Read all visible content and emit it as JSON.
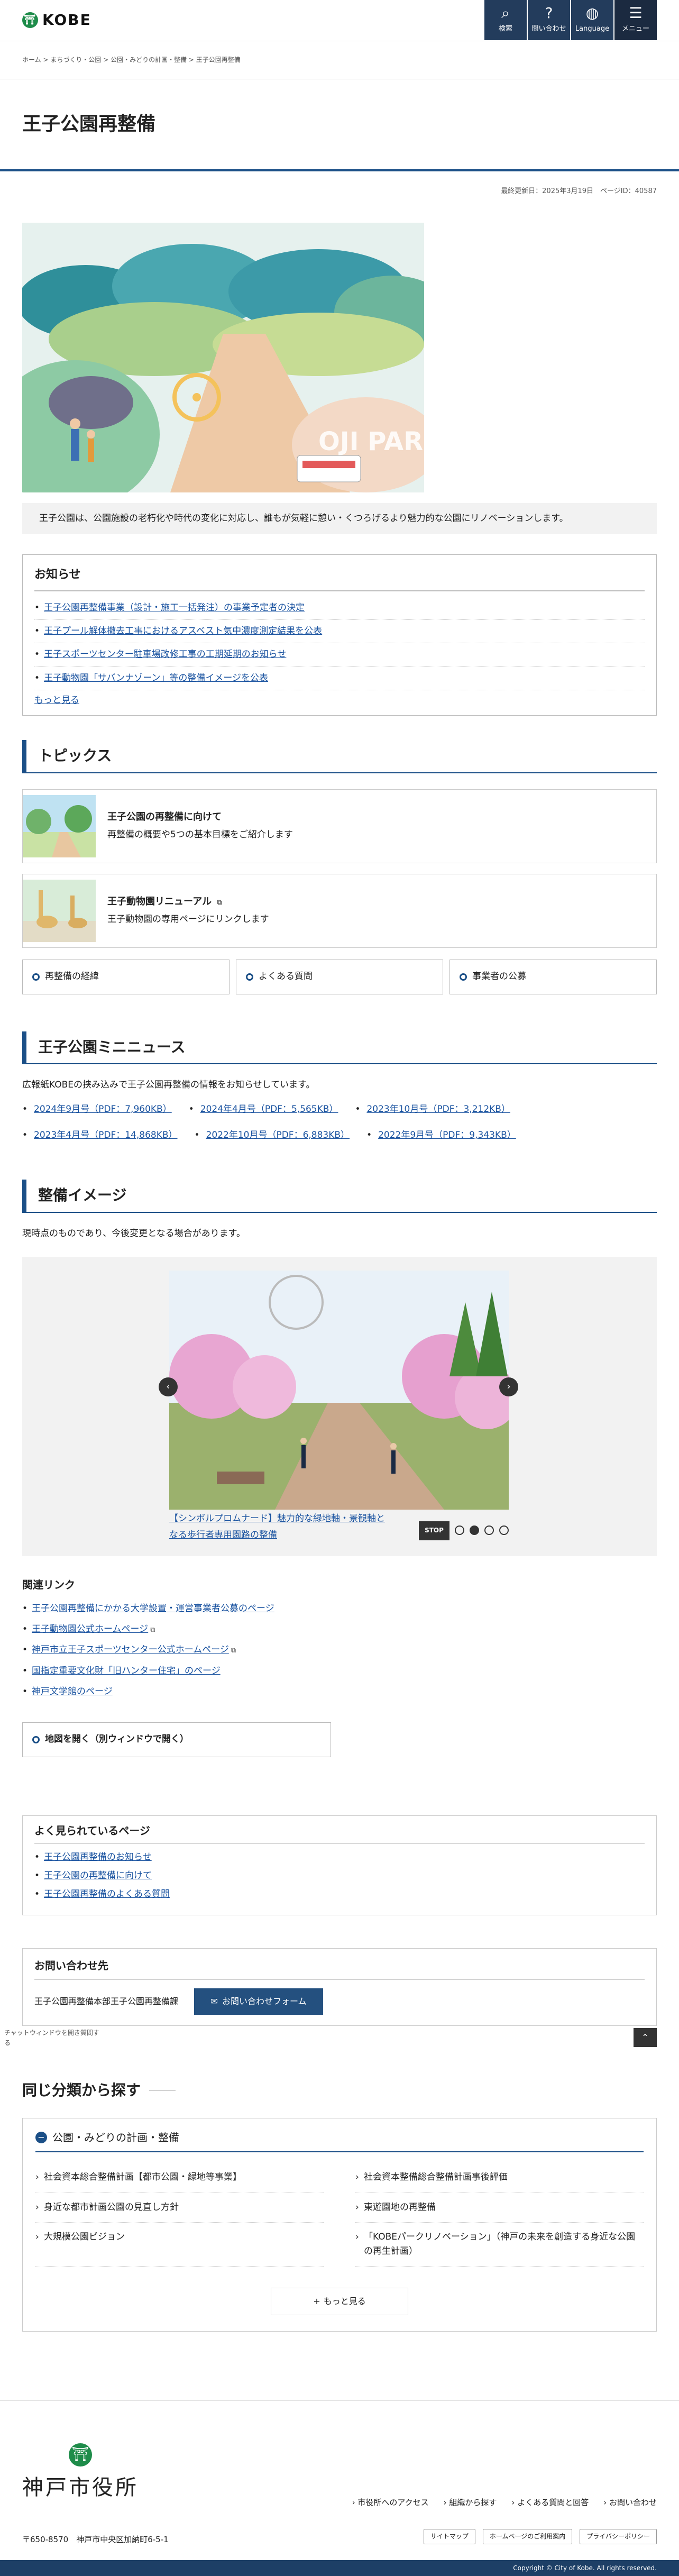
{
  "header": {
    "logo_text": "KOBE",
    "buttons": [
      {
        "label": "検索",
        "icon": "search-icon"
      },
      {
        "label": "問い合わせ",
        "icon": "question-icon"
      },
      {
        "label": "Language",
        "icon": "globe-icon"
      },
      {
        "label": "メニュー",
        "icon": "menu-icon"
      }
    ]
  },
  "breadcrumb": [
    "ホーム",
    "まちづくり・公園",
    "公園・みどりの計画・整備",
    "王子公園再整備"
  ],
  "page": {
    "title": "王子公園再整備",
    "update": "最終更新日：2025年3月19日　ページID：40587",
    "hero_text": "OJI PARK",
    "intro": "王子公園は、公園施設の老朽化や時代の変化に対応し、誰もが気軽に憩い・くつろげるより魅力的な公園にリノベーションします。"
  },
  "notice": {
    "title": "お知らせ",
    "items": [
      "王子公園再整備事業（設計・施工一括発注）の事業予定者の決定",
      "王子プール解体撤去工事におけるアスベスト気中濃度測定結果を公表",
      "王子スポーツセンター駐車場改修工事の工期延期のお知らせ",
      "王子動物園「サバンナゾーン」等の整備イメージを公表"
    ],
    "more": "もっと見る"
  },
  "topics": {
    "title": "トピックス",
    "cards": [
      {
        "title": "王子公園の再整備に向けて",
        "desc": "再整備の概要や5つの基本目標をご紹介します"
      },
      {
        "title": "王子動物園リニューアル",
        "desc": "王子動物園の専用ページにリンクします"
      }
    ],
    "buttons": [
      "再整備の経緯",
      "よくある質問",
      "事業者の公募"
    ]
  },
  "mininews": {
    "title": "王子公園ミニニュース",
    "text": "広報紙KOBEの挟み込みで王子公園再整備の情報をお知らせしています。",
    "links": [
      "2024年9月号（PDF：7,960KB）",
      "2024年4月号（PDF：5,565KB）",
      "2023年10月号（PDF：3,212KB）",
      "2023年4月号（PDF：14,868KB）",
      "2022年10月号（PDF：6,883KB）",
      "2022年9月号（PDF：9,343KB）"
    ]
  },
  "image_section": {
    "title": "整備イメージ",
    "note": "現時点のものであり、今後変更となる場合があります。",
    "caption": "【シンボルプロムナード】魅力的な緑地軸・景観軸となる歩行者専用園路の整備",
    "stop_label": "STOP",
    "active_slide": 2,
    "slide_count": 4
  },
  "related": {
    "title": "関連リンク",
    "items": [
      {
        "label": "王子公園再整備にかかる大学設置・運営事業者公募のページ",
        "ext": false
      },
      {
        "label": "王子動物園公式ホームページ",
        "ext": true
      },
      {
        "label": "神戸市立王子スポーツセンター公式ホームページ",
        "ext": true
      },
      {
        "label": "国指定重要文化財「旧ハンター住宅」のページ",
        "ext": false
      },
      {
        "label": "神戸文学館のページ",
        "ext": false
      }
    ]
  },
  "map_button": "地図を開く（別ウィンドウで開く）",
  "popular": {
    "title": "よく見られているページ",
    "items": [
      "王子公園再整備のお知らせ",
      "王子公園の再整備に向けて",
      "王子公園再整備のよくある質問"
    ]
  },
  "contact": {
    "title": "お問い合わせ先",
    "dept": "王子公園再整備本部王子公園再整備課",
    "button": "お問い合わせフォーム"
  },
  "chat_alt": "チャットウィンドウを開き質問する",
  "same_category": {
    "title": "同じ分類から探す",
    "category": "公園・みどりの計画・整備",
    "items": [
      "社会資本総合整備計画【都市公園・緑地等事業】",
      "社会資本整備総合整備計画事後評価",
      "身近な都市計画公園の見直し方針",
      "東遊園地の再整備",
      "大規模公園ビジョン",
      "「KOBEパークリノベーション」（神戸の未来を創造する身近な公園の再生計画）"
    ],
    "more": "もっと見る"
  },
  "footer": {
    "name": "神戸市役所",
    "links": [
      "市役所へのアクセス",
      "組織から探す",
      "よくある質問と回答",
      "お問い合わせ"
    ],
    "address": "〒650-8570　神戸市中央区加納町6-5-1",
    "buttons": [
      "サイトマップ",
      "ホームページのご利用案内",
      "プライバシーポリシー"
    ],
    "copyright": "Copyright © City of Kobe. All rights reserved."
  }
}
